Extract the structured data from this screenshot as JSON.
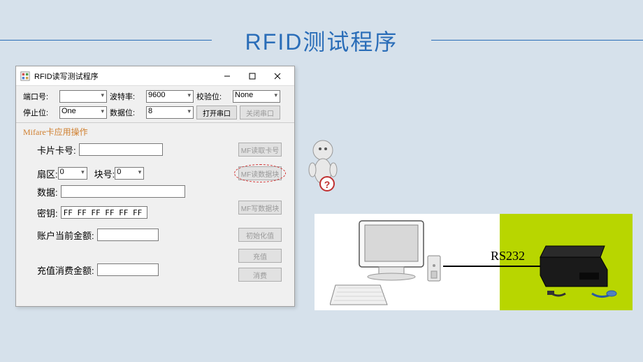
{
  "page_title": "RFID测试程序",
  "window": {
    "title": "RFID读写测试程序",
    "serial": {
      "port_label": "端口号:",
      "port_value": "",
      "baud_label": "波特率:",
      "baud_value": "9600",
      "parity_label": "校验位:",
      "parity_value": "None",
      "stop_label": "停止位:",
      "stop_value": "One",
      "data_label": "数据位:",
      "data_value": "8",
      "open_btn": "打开串口",
      "close_btn": "关闭串口"
    },
    "mifare": {
      "section_title": "Mifare卡应用操作",
      "card_no_label": "卡片卡号:",
      "card_no_value": "",
      "sector_label": "扇区:",
      "sector_value": "0",
      "block_label": "块号:",
      "block_value": "0",
      "data_label": "数据:",
      "data_value": "",
      "key_label": "密钥:",
      "key_value": "FF FF FF FF FF FF",
      "balance_label": "账户当前金额:",
      "balance_value": "",
      "recharge_label": "充值消费金额:",
      "recharge_value": "",
      "btn_read_card": "MF读取卡号",
      "btn_read_block": "MF读数据块",
      "btn_write_block": "MF写数据块",
      "btn_init": "初始化值",
      "btn_recharge": "充值",
      "btn_consume": "消费"
    }
  },
  "diagram": {
    "connection_label": "RS232"
  }
}
